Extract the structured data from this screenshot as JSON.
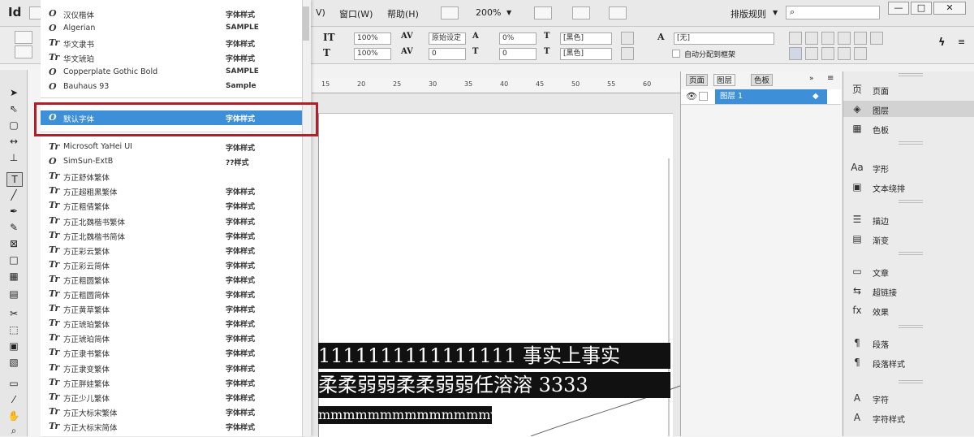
{
  "app": {
    "logo": "Id",
    "menus": [
      "V)",
      "窗口(W)",
      "帮助(H)"
    ],
    "zoom": "200%",
    "workspace": "排版规则",
    "window_buttons": [
      "—",
      "□",
      "✕"
    ]
  },
  "controlbar": {
    "scale_h": "100%",
    "scale_v": "100%",
    "kerning": "原始设定",
    "tracking": "0",
    "baseline": "0%",
    "skew": "0",
    "color_fill": "[黑色]",
    "color_stroke": "[黑色]",
    "lang": "[无]",
    "checkbox_label": "自动分配到框架"
  },
  "font_dropdown": {
    "top_fonts": [
      {
        "icon": "O",
        "name": "汉仪楷体",
        "sample": "字体样式"
      },
      {
        "icon": "O",
        "name": "Algerian",
        "sample": "SAMPLE"
      },
      {
        "icon": "Tr",
        "name": "华文隶书",
        "sample": "字体样式"
      },
      {
        "icon": "Tr",
        "name": "华文琥珀",
        "sample": "字体样式"
      },
      {
        "icon": "O",
        "name": "Copperplate Gothic Bold",
        "sample": "SAMPLE"
      },
      {
        "icon": "O",
        "name": "Bauhaus 93",
        "sample": "Sample"
      }
    ],
    "selected_font": {
      "icon": "O",
      "name": "默认字体",
      "sample": "字体样式"
    },
    "fonts": [
      {
        "icon": "Tr",
        "name": "Microsoft YaHei UI",
        "sample": "字体样式"
      },
      {
        "icon": "O",
        "name": "SimSun-ExtB",
        "sample": "??样式"
      },
      {
        "icon": "Tr",
        "name": "方正舒体繁体",
        "sample": ""
      },
      {
        "icon": "Tr",
        "name": "方正超粗黑繁体",
        "sample": "字体样式"
      },
      {
        "icon": "Tr",
        "name": "方正粗倩繁体",
        "sample": "字体样式"
      },
      {
        "icon": "Tr",
        "name": "方正北魏楷书繁体",
        "sample": "字体样式"
      },
      {
        "icon": "Tr",
        "name": "方正北魏楷书简体",
        "sample": "字体样式"
      },
      {
        "icon": "Tr",
        "name": "方正彩云繁体",
        "sample": "字体样式"
      },
      {
        "icon": "Tr",
        "name": "方正彩云简体",
        "sample": "字体样式"
      },
      {
        "icon": "Tr",
        "name": "方正粗圆繁体",
        "sample": "字体样式"
      },
      {
        "icon": "Tr",
        "name": "方正粗圆简体",
        "sample": "字体样式"
      },
      {
        "icon": "Tr",
        "name": "方正黄草繁体",
        "sample": "字体样式"
      },
      {
        "icon": "Tr",
        "name": "方正琥珀繁体",
        "sample": "字体样式"
      },
      {
        "icon": "Tr",
        "name": "方正琥珀简体",
        "sample": "字体样式"
      },
      {
        "icon": "Tr",
        "name": "方正隶书繁体",
        "sample": "字体样式"
      },
      {
        "icon": "Tr",
        "name": "方正隶变繁体",
        "sample": "字体样式"
      },
      {
        "icon": "Tr",
        "name": "方正胖娃繁体",
        "sample": "字体样式"
      },
      {
        "icon": "Tr",
        "name": "方正少儿繁体",
        "sample": "字体样式"
      },
      {
        "icon": "Tr",
        "name": "方正大标宋繁体",
        "sample": "字体样式"
      },
      {
        "icon": "Tr",
        "name": "方正大标宋简体",
        "sample": "字体样式"
      }
    ]
  },
  "ruler": {
    "labels": [
      "15",
      "20",
      "25",
      "30",
      "35",
      "40",
      "45",
      "50",
      "55",
      "60"
    ]
  },
  "document_text": {
    "line1": "1111111111111111 事实上事实",
    "line2": "柔柔弱弱柔柔弱弱任溶溶 3333",
    "line3": "mmmmmmmmmmmmmmv"
  },
  "layers_panel": {
    "tabs": [
      "页面",
      "图层",
      "色板"
    ],
    "layer_name": "图层 1"
  },
  "dock": {
    "items": [
      {
        "icon": "页",
        "label": "页面"
      },
      {
        "icon": "◈",
        "label": "图层"
      },
      {
        "icon": "▦",
        "label": "色板"
      },
      {
        "icon": "Aa",
        "label": "字形"
      },
      {
        "icon": "▣",
        "label": "文本绕排"
      },
      {
        "icon": "☰",
        "label": "描边"
      },
      {
        "icon": "▤",
        "label": "渐变"
      },
      {
        "icon": "▭",
        "label": "文章"
      },
      {
        "icon": "⇆",
        "label": "超链接"
      },
      {
        "icon": "fx",
        "label": "效果"
      },
      {
        "icon": "¶",
        "label": "段落"
      },
      {
        "icon": "¶",
        "label": "段落样式"
      },
      {
        "icon": "A",
        "label": "字符"
      },
      {
        "icon": "A",
        "label": "字符样式"
      }
    ]
  }
}
